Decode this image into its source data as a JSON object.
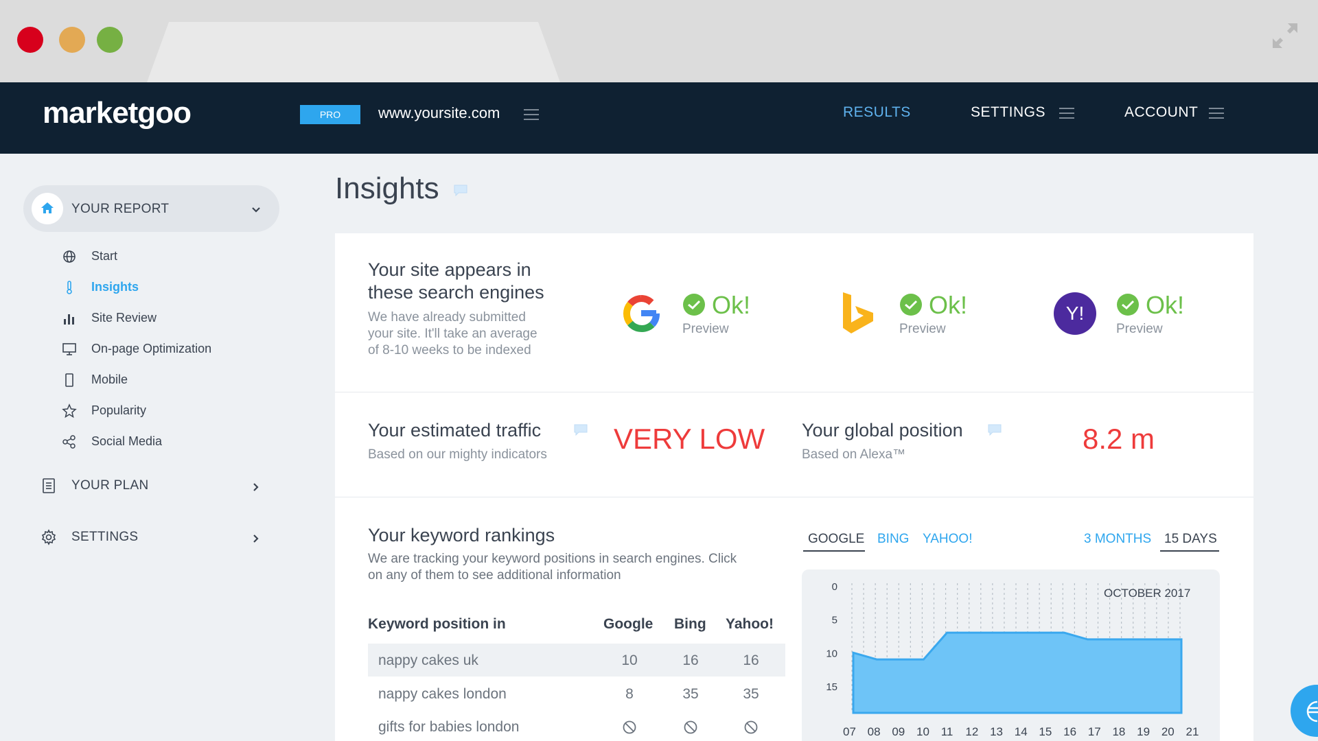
{
  "browser": {
    "window_controls": [
      "close",
      "minimize",
      "maximize"
    ]
  },
  "topnav": {
    "logo": "marketgoo",
    "plan_badge": "PRO",
    "site": "www.yoursite.com",
    "links": {
      "results": "RESULTS",
      "settings": "SETTINGS",
      "account": "ACCOUNT"
    }
  },
  "sidebar": {
    "report_label": "YOUR REPORT",
    "items": [
      "Start",
      "Insights",
      "Site Review",
      "On-page Optimization",
      "Mobile",
      "Popularity",
      "Social Media"
    ],
    "plan_label": "YOUR PLAN",
    "settings_label": "SETTINGS"
  },
  "main": {
    "title": "Insights",
    "engines": {
      "heading_line1": "Your site appears in",
      "heading_line2": "these search engines",
      "desc_line1": "We have already submitted",
      "desc_line2": "your site. It'll take an average",
      "desc_line3": "of 8-10 weeks to be indexed",
      "status_google": "Ok!",
      "status_bing": "Ok!",
      "status_yahoo": "Ok!",
      "preview_google": "Preview",
      "preview_bing": "Preview",
      "preview_yahoo": "Preview",
      "yahoo_logo_text": "Y!"
    },
    "traffic": {
      "heading": "Your estimated traffic",
      "sub": "Based on our mighty indicators",
      "value": "VERY LOW"
    },
    "position": {
      "heading": "Your global position",
      "sub": "Based on Alexa™",
      "value": "8.2 m"
    },
    "keywords": {
      "heading": "Your keyword rankings",
      "desc_line1": "We are tracking your keyword positions in search engines. Click",
      "desc_line2": "on any of them to see additional information",
      "columns": [
        "Keyword position in",
        "Google",
        "Bing",
        "Yahoo!"
      ],
      "rows": [
        {
          "keyword": "nappy cakes uk",
          "google": "10",
          "bing": "16",
          "yahoo": "16"
        },
        {
          "keyword": "nappy cakes london",
          "google": "8",
          "bing": "35",
          "yahoo": "35"
        },
        {
          "keyword": "gifts for babies london",
          "google": "",
          "bing": "",
          "yahoo": ""
        }
      ]
    },
    "chart_tabs": {
      "engines": [
        "GOOGLE",
        "BING",
        "YAHOO!"
      ],
      "ranges": [
        "3 MONTHS",
        "15 DAYS"
      ]
    }
  },
  "colors": {
    "brand_blue": "#2ea6ee",
    "nav_dark": "#0f2132",
    "ok_green": "#6cc04a",
    "alert_red": "#ee3b3b"
  },
  "chart_data": {
    "type": "area",
    "title": "OCTOBER 2017",
    "x": [
      "07",
      "08",
      "09",
      "10",
      "11",
      "12",
      "13",
      "14",
      "15",
      "16",
      "17",
      "18",
      "19",
      "20",
      "21"
    ],
    "series": [
      {
        "values": [
          10,
          11,
          11,
          11,
          7,
          7,
          7,
          7,
          7,
          7,
          8,
          8,
          8,
          8,
          8
        ]
      }
    ],
    "y_ticks": [
      "0",
      "5",
      "10",
      "15"
    ],
    "ylim": [
      0,
      19
    ],
    "y_inverted": true,
    "grid": "vertical dashed"
  }
}
